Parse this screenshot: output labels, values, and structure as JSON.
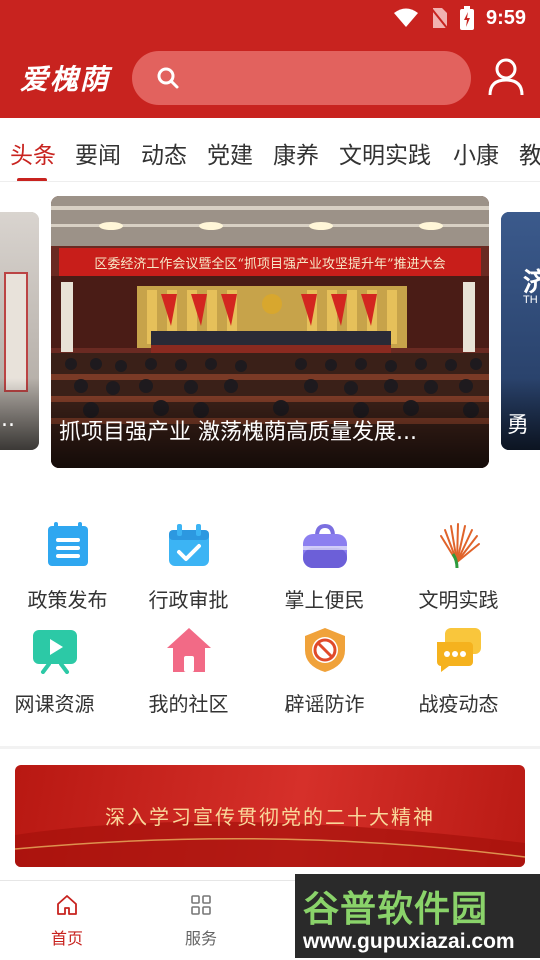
{
  "status_bar": {
    "time": "9:59"
  },
  "header": {
    "logo": "爱槐荫",
    "search_placeholder": ""
  },
  "tabs": [
    {
      "label": "头条",
      "active": true
    },
    {
      "label": "要闻"
    },
    {
      "label": "动态"
    },
    {
      "label": "党建"
    },
    {
      "label": "康养"
    },
    {
      "label": "文明实践"
    },
    {
      "label": "小康"
    },
    {
      "label": "教"
    }
  ],
  "carousel": {
    "main_caption": "抓项目强产业 激荡槐荫高质量发展...",
    "main_banner_text": "区委经济工作会议暨全区“抓项目强产业攻坚提升年”推进大会",
    "left_caption": "...",
    "right_caption": "勇",
    "right_logo_text": "济",
    "right_sub_text": "TH"
  },
  "grid": [
    {
      "label": "政策发布",
      "icon": "document-list-icon"
    },
    {
      "label": "行政审批",
      "icon": "calendar-check-icon"
    },
    {
      "label": "掌上便民",
      "icon": "shopping-bag-icon"
    },
    {
      "label": "文明实践",
      "icon": "civilization-logo-icon"
    },
    {
      "label": "网课资源",
      "icon": "video-play-icon"
    },
    {
      "label": "我的社区",
      "icon": "home-icon"
    },
    {
      "label": "辟谣防诈",
      "icon": "anti-fraud-shield-icon"
    },
    {
      "label": "战疫动态",
      "icon": "chat-bubble-icon"
    }
  ],
  "banner": {
    "text": "深入学习宣传贯彻党的二十大精神"
  },
  "bottom_nav": [
    {
      "label": "首页",
      "icon": "home-outline-icon",
      "active": true
    },
    {
      "label": "服务",
      "icon": "grid-icon"
    }
  ],
  "watermark": {
    "title": "谷普软件园",
    "url": "www.gupuxiazai.com"
  },
  "colors": {
    "brand": "#c8231f",
    "search_bg": "#e2625e",
    "banner_text": "#f9d79a"
  }
}
